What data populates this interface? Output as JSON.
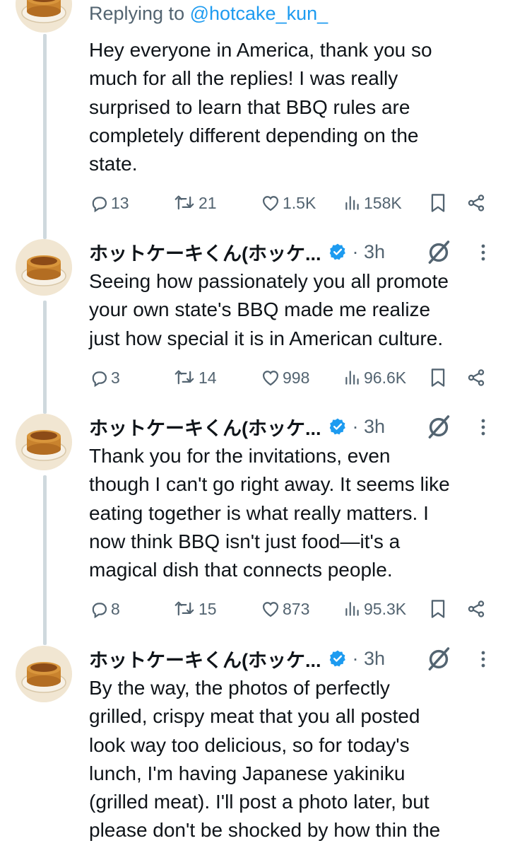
{
  "posts": [
    {
      "reply_prefix": "Replying to ",
      "reply_handle": "@hotcake_kun_",
      "lines": [
        "Hey everyone in America, thank you so",
        "much for all the replies! I was really",
        "surprised to learn that BBQ rules are",
        "completely different depending on the",
        "state."
      ],
      "stats": {
        "replies": "13",
        "reposts": "21",
        "likes": "1.5K",
        "views": "158K"
      }
    },
    {
      "author": "ホットケーキくん(ホッケ...",
      "time": "· 3h",
      "lines": [
        "Seeing how passionately you all promote",
        "your own state's BBQ made me realize",
        "just how special it is in American culture."
      ],
      "stats": {
        "replies": "3",
        "reposts": "14",
        "likes": "998",
        "views": "96.6K"
      }
    },
    {
      "author": "ホットケーキくん(ホッケ...",
      "time": "· 3h",
      "lines": [
        "Thank you for the invitations, even",
        "though I can't go right away. It seems like",
        "eating together is what really matters. I",
        "now think BBQ isn't just food—it's a",
        "magical dish that connects people."
      ],
      "stats": {
        "replies": "8",
        "reposts": "15",
        "likes": "873",
        "views": "95.3K"
      }
    },
    {
      "author": "ホットケーキくん(ホッケ...",
      "time": "· 3h",
      "lines": [
        "By the way, the photos of perfectly",
        "grilled, crispy meat that you all posted",
        "look way too delicious, so for today's",
        "lunch, I'm having Japanese yakiniku",
        "(grilled meat). I'll post a photo later, but",
        "please don't be shocked by how thin the"
      ]
    }
  ],
  "icons": {
    "reply": "speech-bubble-icon",
    "repost": "repost-arrows-icon",
    "like": "heart-icon",
    "views": "bar-chart-icon",
    "bookmark": "bookmark-icon",
    "share": "share-icon",
    "verified": "verified-badge-icon",
    "grok": "grok-icon",
    "more": "more-dots-icon"
  },
  "colors": {
    "link": "#1d9bf0",
    "muted": "#536471",
    "text": "#0f1419",
    "thread": "#cfd9de"
  }
}
